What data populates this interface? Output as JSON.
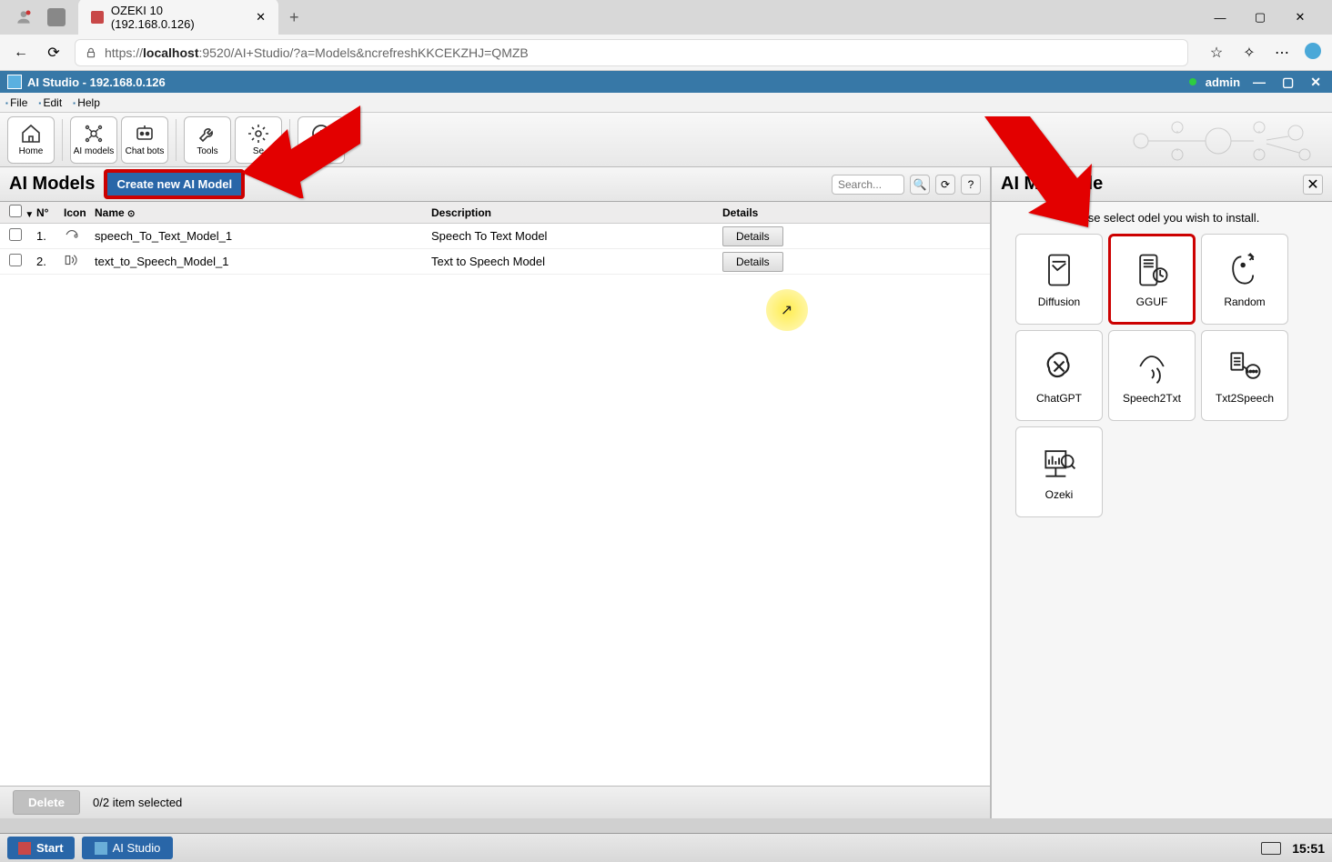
{
  "browser": {
    "tab_title": "OZEKI 10 (192.168.0.126)",
    "url_prefix": "https://",
    "url_host": "localhost",
    "url_port": ":9520",
    "url_path": "/AI+Studio/?a=Models&ncrefreshKKCEKZHJ=QMZB"
  },
  "app": {
    "title": "AI Studio - 192.168.0.126",
    "user": "admin"
  },
  "menubar": {
    "file": "File",
    "edit": "Edit",
    "help": "Help"
  },
  "toolbar": {
    "home": "Home",
    "ai_models": "AI models",
    "chat_bots": "Chat bots",
    "tools": "Tools",
    "settings": "Se",
    "about": "About"
  },
  "main": {
    "title": "AI Models",
    "create_btn": "Create new AI Model",
    "search_placeholder": "Search...",
    "columns": {
      "num": "N°",
      "icon": "Icon",
      "name": "Name",
      "desc": "Description",
      "details": "Details"
    },
    "rows": [
      {
        "n": "1.",
        "name": "speech_To_Text_Model_1",
        "desc": "Speech To Text Model",
        "details": "Details"
      },
      {
        "n": "2.",
        "name": "text_to_Speech_Model_1",
        "desc": "Text to Speech Model",
        "details": "Details"
      }
    ],
    "footer": {
      "delete": "Delete",
      "selection": "0/2 item selected"
    }
  },
  "side": {
    "title": "AI Model de",
    "instruction": "Please select          odel you wish to install.",
    "tiles": {
      "diffusion": "Diffusion",
      "gguf": "GGUF",
      "random": "Random",
      "chatgpt": "ChatGPT",
      "speech2txt": "Speech2Txt",
      "txt2speech": "Txt2Speech",
      "ozeki": "Ozeki"
    }
  },
  "taskbar": {
    "start": "Start",
    "app": "AI Studio",
    "time": "15:51"
  }
}
